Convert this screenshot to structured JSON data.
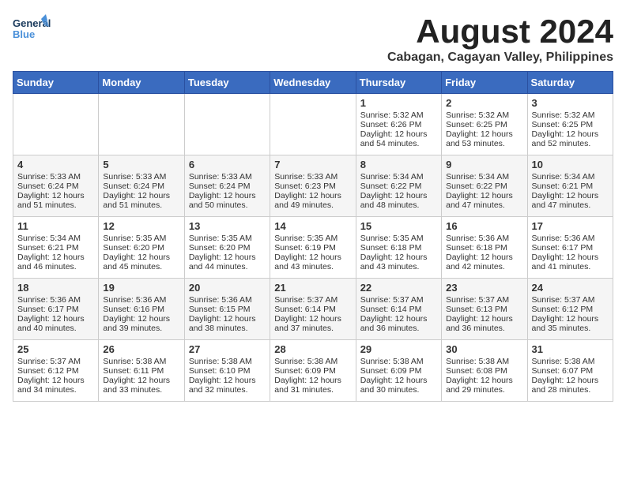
{
  "logo": {
    "general": "General",
    "blue": "Blue"
  },
  "title": "August 2024",
  "subtitle": "Cabagan, Cagayan Valley, Philippines",
  "days_of_week": [
    "Sunday",
    "Monday",
    "Tuesday",
    "Wednesday",
    "Thursday",
    "Friday",
    "Saturday"
  ],
  "weeks": [
    [
      {
        "day": "",
        "info": ""
      },
      {
        "day": "",
        "info": ""
      },
      {
        "day": "",
        "info": ""
      },
      {
        "day": "",
        "info": ""
      },
      {
        "day": "1",
        "info": "Sunrise: 5:32 AM\nSunset: 6:26 PM\nDaylight: 12 hours\nand 54 minutes."
      },
      {
        "day": "2",
        "info": "Sunrise: 5:32 AM\nSunset: 6:25 PM\nDaylight: 12 hours\nand 53 minutes."
      },
      {
        "day": "3",
        "info": "Sunrise: 5:32 AM\nSunset: 6:25 PM\nDaylight: 12 hours\nand 52 minutes."
      }
    ],
    [
      {
        "day": "4",
        "info": "Sunrise: 5:33 AM\nSunset: 6:24 PM\nDaylight: 12 hours\nand 51 minutes."
      },
      {
        "day": "5",
        "info": "Sunrise: 5:33 AM\nSunset: 6:24 PM\nDaylight: 12 hours\nand 51 minutes."
      },
      {
        "day": "6",
        "info": "Sunrise: 5:33 AM\nSunset: 6:24 PM\nDaylight: 12 hours\nand 50 minutes."
      },
      {
        "day": "7",
        "info": "Sunrise: 5:33 AM\nSunset: 6:23 PM\nDaylight: 12 hours\nand 49 minutes."
      },
      {
        "day": "8",
        "info": "Sunrise: 5:34 AM\nSunset: 6:22 PM\nDaylight: 12 hours\nand 48 minutes."
      },
      {
        "day": "9",
        "info": "Sunrise: 5:34 AM\nSunset: 6:22 PM\nDaylight: 12 hours\nand 47 minutes."
      },
      {
        "day": "10",
        "info": "Sunrise: 5:34 AM\nSunset: 6:21 PM\nDaylight: 12 hours\nand 47 minutes."
      }
    ],
    [
      {
        "day": "11",
        "info": "Sunrise: 5:34 AM\nSunset: 6:21 PM\nDaylight: 12 hours\nand 46 minutes."
      },
      {
        "day": "12",
        "info": "Sunrise: 5:35 AM\nSunset: 6:20 PM\nDaylight: 12 hours\nand 45 minutes."
      },
      {
        "day": "13",
        "info": "Sunrise: 5:35 AM\nSunset: 6:20 PM\nDaylight: 12 hours\nand 44 minutes."
      },
      {
        "day": "14",
        "info": "Sunrise: 5:35 AM\nSunset: 6:19 PM\nDaylight: 12 hours\nand 43 minutes."
      },
      {
        "day": "15",
        "info": "Sunrise: 5:35 AM\nSunset: 6:18 PM\nDaylight: 12 hours\nand 43 minutes."
      },
      {
        "day": "16",
        "info": "Sunrise: 5:36 AM\nSunset: 6:18 PM\nDaylight: 12 hours\nand 42 minutes."
      },
      {
        "day": "17",
        "info": "Sunrise: 5:36 AM\nSunset: 6:17 PM\nDaylight: 12 hours\nand 41 minutes."
      }
    ],
    [
      {
        "day": "18",
        "info": "Sunrise: 5:36 AM\nSunset: 6:17 PM\nDaylight: 12 hours\nand 40 minutes."
      },
      {
        "day": "19",
        "info": "Sunrise: 5:36 AM\nSunset: 6:16 PM\nDaylight: 12 hours\nand 39 minutes."
      },
      {
        "day": "20",
        "info": "Sunrise: 5:36 AM\nSunset: 6:15 PM\nDaylight: 12 hours\nand 38 minutes."
      },
      {
        "day": "21",
        "info": "Sunrise: 5:37 AM\nSunset: 6:14 PM\nDaylight: 12 hours\nand 37 minutes."
      },
      {
        "day": "22",
        "info": "Sunrise: 5:37 AM\nSunset: 6:14 PM\nDaylight: 12 hours\nand 36 minutes."
      },
      {
        "day": "23",
        "info": "Sunrise: 5:37 AM\nSunset: 6:13 PM\nDaylight: 12 hours\nand 36 minutes."
      },
      {
        "day": "24",
        "info": "Sunrise: 5:37 AM\nSunset: 6:12 PM\nDaylight: 12 hours\nand 35 minutes."
      }
    ],
    [
      {
        "day": "25",
        "info": "Sunrise: 5:37 AM\nSunset: 6:12 PM\nDaylight: 12 hours\nand 34 minutes."
      },
      {
        "day": "26",
        "info": "Sunrise: 5:38 AM\nSunset: 6:11 PM\nDaylight: 12 hours\nand 33 minutes."
      },
      {
        "day": "27",
        "info": "Sunrise: 5:38 AM\nSunset: 6:10 PM\nDaylight: 12 hours\nand 32 minutes."
      },
      {
        "day": "28",
        "info": "Sunrise: 5:38 AM\nSunset: 6:09 PM\nDaylight: 12 hours\nand 31 minutes."
      },
      {
        "day": "29",
        "info": "Sunrise: 5:38 AM\nSunset: 6:09 PM\nDaylight: 12 hours\nand 30 minutes."
      },
      {
        "day": "30",
        "info": "Sunrise: 5:38 AM\nSunset: 6:08 PM\nDaylight: 12 hours\nand 29 minutes."
      },
      {
        "day": "31",
        "info": "Sunrise: 5:38 AM\nSunset: 6:07 PM\nDaylight: 12 hours\nand 28 minutes."
      }
    ]
  ]
}
